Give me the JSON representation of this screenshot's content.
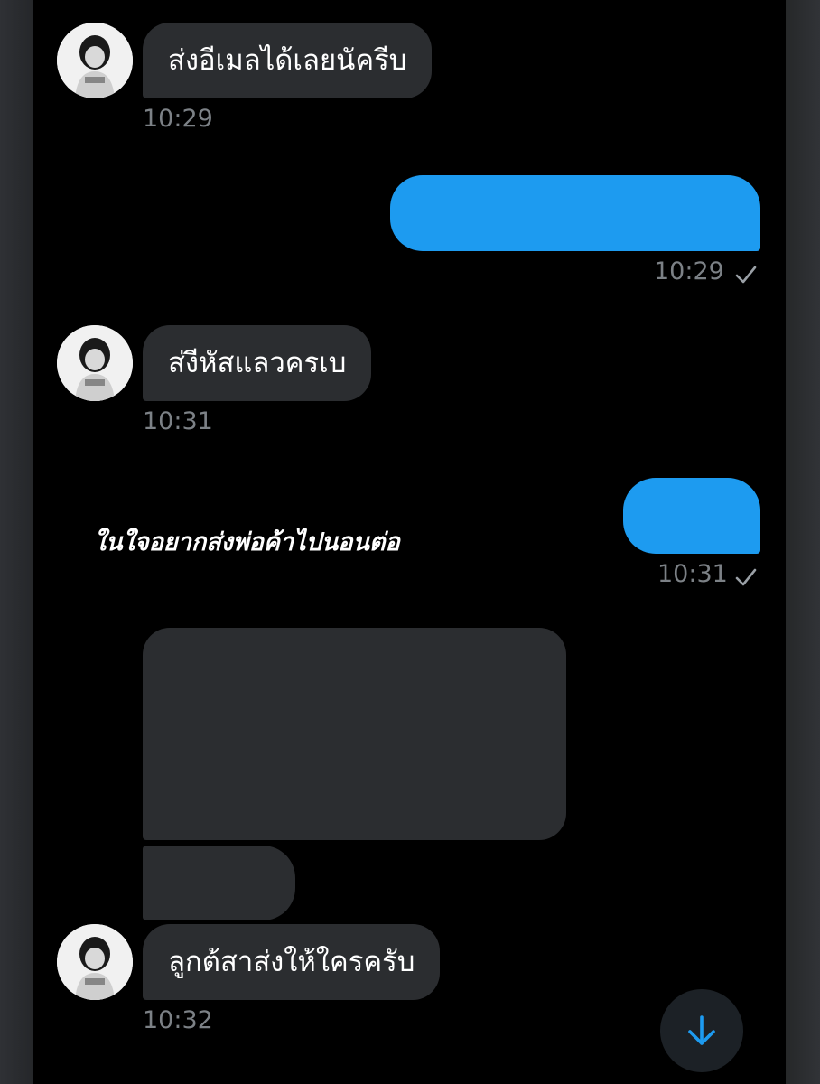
{
  "accent_color": "#1d9bf0",
  "incoming_bubble_color": "#2b2d30",
  "messages": [
    {
      "side": "incoming",
      "text": "ส่งอีเมลได้เลยนัครีบ",
      "time": "10:29"
    },
    {
      "side": "outgoing",
      "text": "",
      "time": "10:29",
      "status_icon": "check-icon"
    },
    {
      "side": "incoming",
      "text": "ส่งีหัสแลวครเบ",
      "time": "10:31"
    },
    {
      "side": "outgoing",
      "text": "",
      "time": "10:31",
      "status_icon": "check-icon"
    },
    {
      "side": "incoming",
      "text": "",
      "time": ""
    },
    {
      "side": "incoming",
      "text": "",
      "time": ""
    },
    {
      "side": "incoming",
      "text": "ลูกต้สาส่งให้ใครครับ",
      "time": "10:32"
    }
  ],
  "overlay_caption": "ในใจอยากส่งพ่อค้าไปนอนต่อ",
  "scroll_button": {
    "icon": "arrow-down-icon"
  }
}
